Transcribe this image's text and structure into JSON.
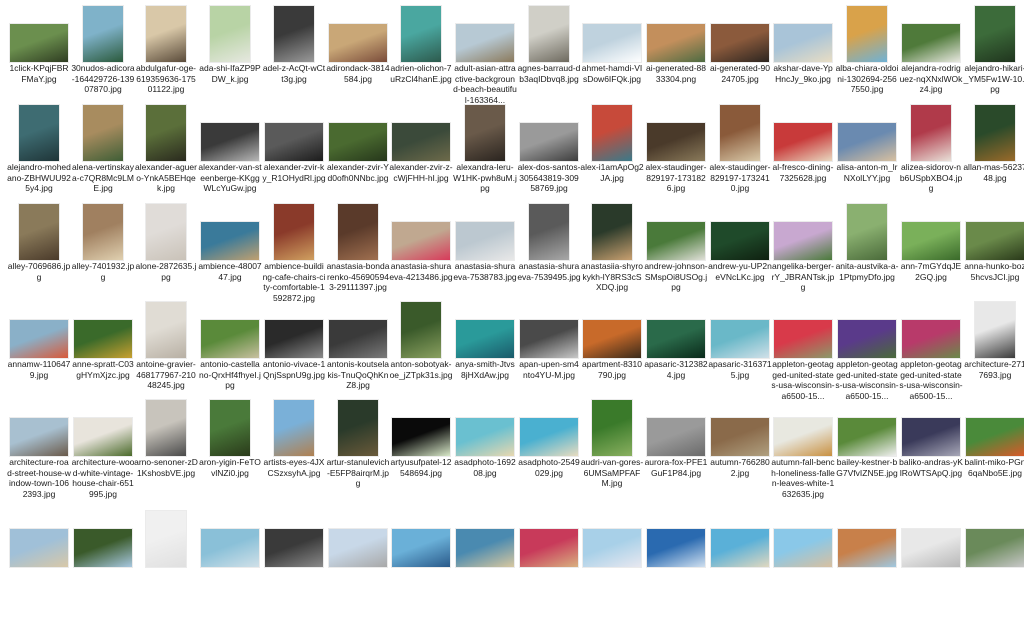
{
  "file_view": {
    "rows": [
      [
        {
          "name": "1click-KPqjFBRFMaY.jpg",
          "orient": "l",
          "colors": [
            "#6b8f4e",
            "#2f3d22"
          ]
        },
        {
          "name": "30nudos-adicora-164429726-13907870.jpg",
          "orient": "p",
          "colors": [
            "#7fb2c9",
            "#2b5a3c"
          ]
        },
        {
          "name": "abdulgafur-oge-619359636-17501122.jpg",
          "orient": "p",
          "colors": [
            "#d9c8a8",
            "#5a4b3a"
          ]
        },
        {
          "name": "ada-shi-IfaZP9PDW_k.jpg",
          "orient": "p",
          "colors": [
            "#b8d3a5",
            "#e6e8e0"
          ]
        },
        {
          "name": "adel-z-AcQt-wCtt3g.jpg",
          "orient": "p",
          "colors": [
            "#3a3a3a",
            "#9a9a9a"
          ]
        },
        {
          "name": "adirondack-3814584.jpg",
          "orient": "l",
          "colors": [
            "#c9a777",
            "#7a4c3a"
          ]
        },
        {
          "name": "adrien-olichon-7uRzCl4hanE.jpg",
          "orient": "p",
          "colors": [
            "#4aa7a0",
            "#2d5a4d"
          ]
        },
        {
          "name": "adult-asian-attractive-background-beach-beautiful-163364...",
          "orient": "l",
          "colors": [
            "#b7c9d4",
            "#8b7a5c"
          ]
        },
        {
          "name": "agnes-barraud-db3aqIDbvq8.jpg",
          "orient": "p",
          "colors": [
            "#d0cfc7",
            "#6e6a5f"
          ]
        },
        {
          "name": "ahmet-hamdi-VIsDow6IFQk.jpg",
          "orient": "l",
          "colors": [
            "#bfd2de",
            "#ffffff"
          ]
        },
        {
          "name": "ai-generated-8833304.png",
          "orient": "l",
          "colors": [
            "#c38f5c",
            "#4d6b42"
          ]
        },
        {
          "name": "ai-generated-9024705.jpg",
          "orient": "l",
          "colors": [
            "#8b5a3c",
            "#2c2520"
          ]
        },
        {
          "name": "akshar-dave-YpHncJy_9ko.jpg",
          "orient": "l",
          "colors": [
            "#a9c4d8",
            "#e8ddc4"
          ]
        },
        {
          "name": "alba-chiara-oldoini-1302694-2567550.jpg",
          "orient": "p",
          "colors": [
            "#d9a24a",
            "#6fb2d6"
          ]
        },
        {
          "name": "alejandra-rodriguez-nqXNxlWOkz4.jpg",
          "orient": "l",
          "colors": [
            "#4f7a3a",
            "#e8e8e0"
          ]
        },
        {
          "name": "alejandro-hikari-_YM5Fw1W-10.jpg",
          "orient": "p",
          "colors": [
            "#3c6b3a",
            "#20351e"
          ]
        }
      ],
      [
        {
          "name": "alejandro-mohedano-ZBHWUU925y4.jpg",
          "orient": "p",
          "colors": [
            "#3e6c72",
            "#1f3538"
          ]
        },
        {
          "name": "alena-vertinskaya-c7QR8Mc9LME.jpg",
          "orient": "p",
          "colors": [
            "#a88c5f",
            "#3f5e36"
          ]
        },
        {
          "name": "alexander-aguero-YnkA5BEHqek.jpg",
          "orient": "p",
          "colors": [
            "#5b6f3a",
            "#2a2a1e"
          ]
        },
        {
          "name": "alexander-van-steenberge-KKggWLcYuGw.jpg",
          "orient": "l",
          "colors": [
            "#3a3a3a",
            "#b7b7b7"
          ]
        },
        {
          "name": "alexander-zvir-ky_R1OHydRl.jpg",
          "orient": "l",
          "colors": [
            "#5a5a5a",
            "#1c1c1c"
          ]
        },
        {
          "name": "alexander-zvir-Yd0ofh0NNbc.jpg",
          "orient": "l",
          "colors": [
            "#4a6a30",
            "#26371b"
          ]
        },
        {
          "name": "alexander-zvir-z-cWjFHH-hI.jpg",
          "orient": "l",
          "colors": [
            "#3b4a3a",
            "#6d6a4a"
          ]
        },
        {
          "name": "alexandra-leru-W1HK-pwh8uM.jpg",
          "orient": "p",
          "colors": [
            "#6a5a4a",
            "#2a241f"
          ]
        },
        {
          "name": "alex-dos-santos-305643819-30958769.jpg",
          "orient": "l",
          "colors": [
            "#9a9a9a",
            "#3d3d3d"
          ]
        },
        {
          "name": "alex-i1amApOg2JA.jpg",
          "orient": "p",
          "colors": [
            "#c74a3a",
            "#3a7a8a"
          ]
        },
        {
          "name": "alex-staudinger-829197-1731826.jpg",
          "orient": "l",
          "colors": [
            "#4a3a2a",
            "#8a7a5a"
          ]
        },
        {
          "name": "alex-staudinger-829197-1732410.jpg",
          "orient": "p",
          "colors": [
            "#8a5a3a",
            "#d9c9a9"
          ]
        },
        {
          "name": "al-fresco-dining-7325628.jpg",
          "orient": "l",
          "colors": [
            "#c83a3a",
            "#e8d8c0"
          ]
        },
        {
          "name": "alisa-anton-m_lrNXolLYY.jpg",
          "orient": "l",
          "colors": [
            "#6a8ab0",
            "#d8c0a0"
          ]
        },
        {
          "name": "alizea-sidorov-nb6USpbXBO4.jpg",
          "orient": "p",
          "colors": [
            "#b03a4a",
            "#e8e0d8"
          ]
        },
        {
          "name": "allan-mas-5623748.jpg",
          "orient": "p",
          "colors": [
            "#2a4a2a",
            "#9a6a2a"
          ]
        }
      ],
      [
        {
          "name": "alley-7069686.jpg",
          "orient": "p",
          "colors": [
            "#8a7a5a",
            "#4a3a2a"
          ]
        },
        {
          "name": "alley-7401932.jpg",
          "orient": "p",
          "colors": [
            "#a08060",
            "#e0d0b0"
          ]
        },
        {
          "name": "alone-2872635.jpg",
          "orient": "p",
          "colors": [
            "#e0dcd8",
            "#c9c2b8"
          ]
        },
        {
          "name": "ambience-4800747.jpg",
          "orient": "l",
          "colors": [
            "#3a7a9a",
            "#c0a070"
          ]
        },
        {
          "name": "ambience-building-cafe-chairs-city-comfortable-1592872.jpg",
          "orient": "p",
          "colors": [
            "#8a3a2a",
            "#d0a060"
          ]
        },
        {
          "name": "anastasia-bondarenko-456905943-29111397.jpg",
          "orient": "p",
          "colors": [
            "#5a3a2a",
            "#a07050"
          ]
        },
        {
          "name": "anastasia-shuraeva-4213486.jpg",
          "orient": "l",
          "colors": [
            "#c0a890",
            "#d83a5a"
          ]
        },
        {
          "name": "anastasia-shuraeva-7538783.jpg",
          "orient": "l",
          "colors": [
            "#bcc8d0",
            "#e8e8e8"
          ]
        },
        {
          "name": "anastasia-shuraeva-7539495.jpg",
          "orient": "p",
          "colors": [
            "#5a5a5a",
            "#a8a8a8"
          ]
        },
        {
          "name": "anastasiia-shyrokykh-lY8RS3cSXDQ.jpg",
          "orient": "p",
          "colors": [
            "#2a3a2a",
            "#c8a070"
          ]
        },
        {
          "name": "andrew-johnson-SMspOi8USOg.jpg",
          "orient": "l",
          "colors": [
            "#4a7a3a",
            "#e0e0d8"
          ]
        },
        {
          "name": "andrew-yu-UP2neVNcLKc.jpg",
          "orient": "l",
          "colors": [
            "#1f4a2a",
            "#0f2010"
          ]
        },
        {
          "name": "angelika-berger-rY_JBRANTsk.jpg",
          "orient": "l",
          "colors": [
            "#c8a8d0",
            "#4a7a3a"
          ]
        },
        {
          "name": "anita-austvika-a-1PtpmyDfo.jpg",
          "orient": "p",
          "colors": [
            "#8ab070",
            "#4a6a3a"
          ]
        },
        {
          "name": "ann-7mGYdqJE2GQ.jpg",
          "orient": "l",
          "colors": [
            "#7ab05a",
            "#3a6a2a"
          ]
        },
        {
          "name": "anna-hunko-boz5hcvsJCI.jpg",
          "orient": "l",
          "colors": [
            "#6a8a4a",
            "#2a3a1a"
          ]
        }
      ],
      [
        {
          "name": "annamw-1106479.jpg",
          "orient": "l",
          "colors": [
            "#8ab0c8",
            "#d85a3a"
          ]
        },
        {
          "name": "anne-spratt-C03gHYmXjzc.jpg",
          "orient": "l",
          "colors": [
            "#3a6a2a",
            "#c8a030"
          ]
        },
        {
          "name": "antoine-gravier-468177967-21048245.jpg",
          "orient": "p",
          "colors": [
            "#e0dcd4",
            "#b8b0a4"
          ]
        },
        {
          "name": "antonio-castellano-QrxHf4fhyeI.jpg",
          "orient": "l",
          "colors": [
            "#5a8a3a",
            "#c8c0a0"
          ]
        },
        {
          "name": "antonio-vivace-1QnjSspnU9g.jpg",
          "orient": "l",
          "colors": [
            "#2a2a2a",
            "#8a8a8a"
          ]
        },
        {
          "name": "antonis-koutselakis-TnuQoQhKnZ8.jpg",
          "orient": "l",
          "colors": [
            "#3a3a3a",
            "#7a7a7a"
          ]
        },
        {
          "name": "anton-sobotyak-oe_jZTpk31s.jpg",
          "orient": "p",
          "colors": [
            "#3a5a2a",
            "#8aa060"
          ]
        },
        {
          "name": "anya-smith-Jtvs8jHXdAw.jpg",
          "orient": "l",
          "colors": [
            "#2a9a9a",
            "#1a5a6a"
          ]
        },
        {
          "name": "apan-upen-sm4nto4YU-M.jpg",
          "orient": "l",
          "colors": [
            "#4a4a4a",
            "#c8c8c8"
          ]
        },
        {
          "name": "apartment-8310790.jpg",
          "orient": "l",
          "colors": [
            "#c86a2a",
            "#3a2a1a"
          ]
        },
        {
          "name": "apasaric-3123824.jpg",
          "orient": "l",
          "colors": [
            "#2a6a4a",
            "#0a2a1a"
          ]
        },
        {
          "name": "apasaric-3163715.jpg",
          "orient": "l",
          "colors": [
            "#6ab8c8",
            "#d0e0e8"
          ]
        },
        {
          "name": "appleton-geotagged-united-states-usa-wisconsin-a6500-15...",
          "orient": "l",
          "colors": [
            "#d83a4a",
            "#8a9a6a"
          ]
        },
        {
          "name": "appleton-geotagged-united-states-usa-wisconsin-a6500-15...",
          "orient": "l",
          "colors": [
            "#5a3a8a",
            "#4a6a3a"
          ]
        },
        {
          "name": "appleton-geotagged-united-states-usa-wisconsin-a6500-15...",
          "orient": "l",
          "colors": [
            "#b83a6a",
            "#6a8a4a"
          ]
        },
        {
          "name": "architecture-2717693.jpg",
          "orient": "p",
          "colors": [
            "#e8e8e8",
            "#3a3a3a"
          ]
        }
      ],
      [
        {
          "name": "architecture-road-street-house-window-town-1062393.jpg",
          "orient": "l",
          "colors": [
            "#a8c0d0",
            "#6a5a4a"
          ]
        },
        {
          "name": "architecture-wood-white-vintage-house-chair-651995.jpg",
          "orient": "l",
          "colors": [
            "#e8e4dc",
            "#4a6a2a"
          ]
        },
        {
          "name": "arno-senoner-zD1KshosbVE.jpg",
          "orient": "p",
          "colors": [
            "#c8c4bc",
            "#4a4a4a"
          ]
        },
        {
          "name": "aron-yigin-FeTOvlNZi0.jpg",
          "orient": "p",
          "colors": [
            "#4a7a3a",
            "#2a3a1a"
          ]
        },
        {
          "name": "artists-eyes-4JXCSzxsyhA.jpg",
          "orient": "p",
          "colors": [
            "#7ab0d8",
            "#b08050"
          ]
        },
        {
          "name": "artur-stanulevich-E5FP8airqrM.jpg",
          "orient": "p",
          "colors": [
            "#2a3a2a",
            "#6a5a3a"
          ]
        },
        {
          "name": "artyusufpatel-12548694.jpg",
          "orient": "l",
          "colors": [
            "#0a0a0a",
            "#d8e8c8"
          ]
        },
        {
          "name": "asadphoto-169208.jpg",
          "orient": "l",
          "colors": [
            "#6ac0d0",
            "#e8d8b0"
          ]
        },
        {
          "name": "asadphoto-2549029.jpg",
          "orient": "l",
          "colors": [
            "#4ab0d0",
            "#e8dcc0"
          ]
        },
        {
          "name": "audri-van-gores-6UMSaMPFAFM.jpg",
          "orient": "p",
          "colors": [
            "#3a7a2a",
            "#8ab060"
          ]
        },
        {
          "name": "aurora-fox-PFE1GuF1P84.jpg",
          "orient": "l",
          "colors": [
            "#9a9a9a",
            "#6a6a6a"
          ]
        },
        {
          "name": "autumn-7662802.jpg",
          "orient": "l",
          "colors": [
            "#8a6a4a",
            "#b0a080"
          ]
        },
        {
          "name": "autumn-fall-bench-loneliness-fallen-leaves-white-1632635.jpg",
          "orient": "l",
          "colors": [
            "#e8e8e0",
            "#c89040"
          ]
        },
        {
          "name": "bailey-kestner-bG7VfvIZN5E.jpg",
          "orient": "l",
          "colors": [
            "#5a8a3a",
            "#f0f0f0"
          ]
        },
        {
          "name": "baliko-andras-yKlRoWTSApQ.jpg",
          "orient": "l",
          "colors": [
            "#3a3a5a",
            "#a8a8b8"
          ]
        },
        {
          "name": "balint-miko-PGn6qaNbo5E.jpg",
          "orient": "l",
          "colors": [
            "#4a8a3a",
            "#d85a2a"
          ]
        }
      ],
      [
        {
          "name": "",
          "orient": "l",
          "colors": [
            "#a0c0d8",
            "#d8c8a8"
          ]
        },
        {
          "name": "",
          "orient": "l",
          "colors": [
            "#3a5a2a",
            "#a8c8e0"
          ]
        },
        {
          "name": "",
          "orient": "p",
          "colors": [
            "#f0f0f0",
            "#e0e0e0"
          ]
        },
        {
          "name": "",
          "orient": "l",
          "colors": [
            "#8ac0d8",
            "#d0e0e8"
          ]
        },
        {
          "name": "",
          "orient": "l",
          "colors": [
            "#3a3a3a",
            "#8a8a8a"
          ]
        },
        {
          "name": "",
          "orient": "l",
          "colors": [
            "#c8d8e8",
            "#a8a8a8"
          ]
        },
        {
          "name": "",
          "orient": "l",
          "colors": [
            "#6ab0d8",
            "#2a5a8a"
          ]
        },
        {
          "name": "",
          "orient": "l",
          "colors": [
            "#4a8ab0",
            "#d8c8a0"
          ]
        },
        {
          "name": "",
          "orient": "l",
          "colors": [
            "#c83a5a",
            "#d8b080"
          ]
        },
        {
          "name": "",
          "orient": "l",
          "colors": [
            "#a8d0e8",
            "#e8e8f0"
          ]
        },
        {
          "name": "",
          "orient": "l",
          "colors": [
            "#2a6ab0",
            "#d0e0f0"
          ]
        },
        {
          "name": "",
          "orient": "l",
          "colors": [
            "#5ab0d8",
            "#e0d8c0"
          ]
        },
        {
          "name": "",
          "orient": "l",
          "colors": [
            "#8ac8e8",
            "#d8c0a0"
          ]
        },
        {
          "name": "",
          "orient": "l",
          "colors": [
            "#c8804a",
            "#a0c8e0"
          ]
        },
        {
          "name": "",
          "orient": "l",
          "colors": [
            "#e8e8e8",
            "#b8b8b8"
          ]
        },
        {
          "name": "",
          "orient": "l",
          "colors": [
            "#6a8a5a",
            "#c8c8c8"
          ]
        }
      ]
    ]
  }
}
